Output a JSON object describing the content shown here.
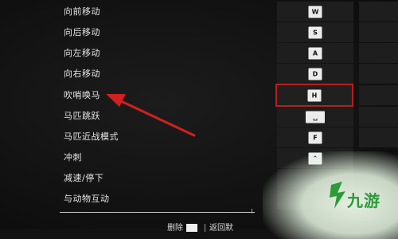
{
  "actions": [
    {
      "label": "向前移动",
      "key": "W"
    },
    {
      "label": "向后移动",
      "key": "S"
    },
    {
      "label": "向左移动",
      "key": "A"
    },
    {
      "label": "向右移动",
      "key": "D"
    },
    {
      "label": "吹哨唤马",
      "key": "H",
      "highlighted": true
    },
    {
      "label": "马匹跳跃",
      "key": "␣"
    },
    {
      "label": "马匹近战模式",
      "key": "F"
    },
    {
      "label": "冲刺",
      "key": "⌃"
    },
    {
      "label": "减速/停下",
      "key": ""
    },
    {
      "label": "与动物互动",
      "key": ""
    }
  ],
  "bottom_bar": {
    "delete_label": "删除",
    "back_label": "返回默"
  },
  "watermark": {
    "text": "九游"
  },
  "colors": {
    "highlight": "#b5201e",
    "arrow": "#d21f1f",
    "watermark": "#2d9a3a"
  }
}
